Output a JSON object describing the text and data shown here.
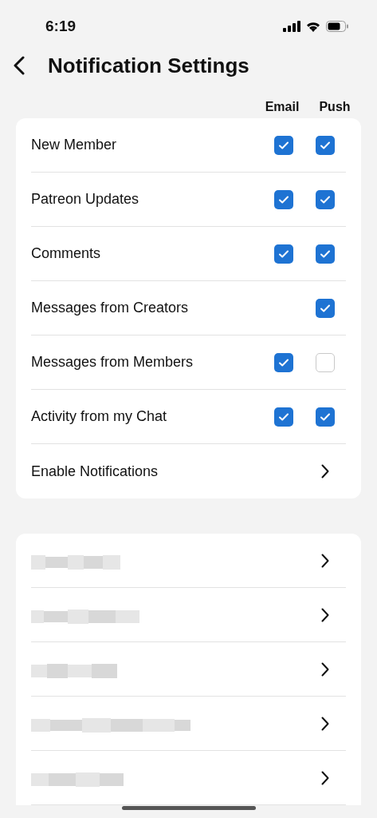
{
  "status_bar": {
    "time": "6:19"
  },
  "header": {
    "title": "Notification Settings"
  },
  "columns": [
    "Email",
    "Push"
  ],
  "settings": [
    {
      "kind": "both",
      "label": "New Member",
      "email": true,
      "push": true
    },
    {
      "kind": "both",
      "label": "Patreon Updates",
      "email": true,
      "push": true
    },
    {
      "kind": "both",
      "label": "Comments",
      "email": true,
      "push": true
    },
    {
      "kind": "push-only",
      "label": "Messages from Creators",
      "push": true
    },
    {
      "kind": "both",
      "label": "Messages from Members",
      "email": true,
      "push": false
    },
    {
      "kind": "both",
      "label": "Activity from my Chat",
      "email": true,
      "push": true
    },
    {
      "kind": "link",
      "label": "Enable Notifications"
    }
  ],
  "hidden_rows": [
    {
      "kind": "redacted"
    },
    {
      "kind": "redacted"
    },
    {
      "kind": "redacted"
    },
    {
      "kind": "redacted"
    },
    {
      "kind": "redacted"
    }
  ]
}
